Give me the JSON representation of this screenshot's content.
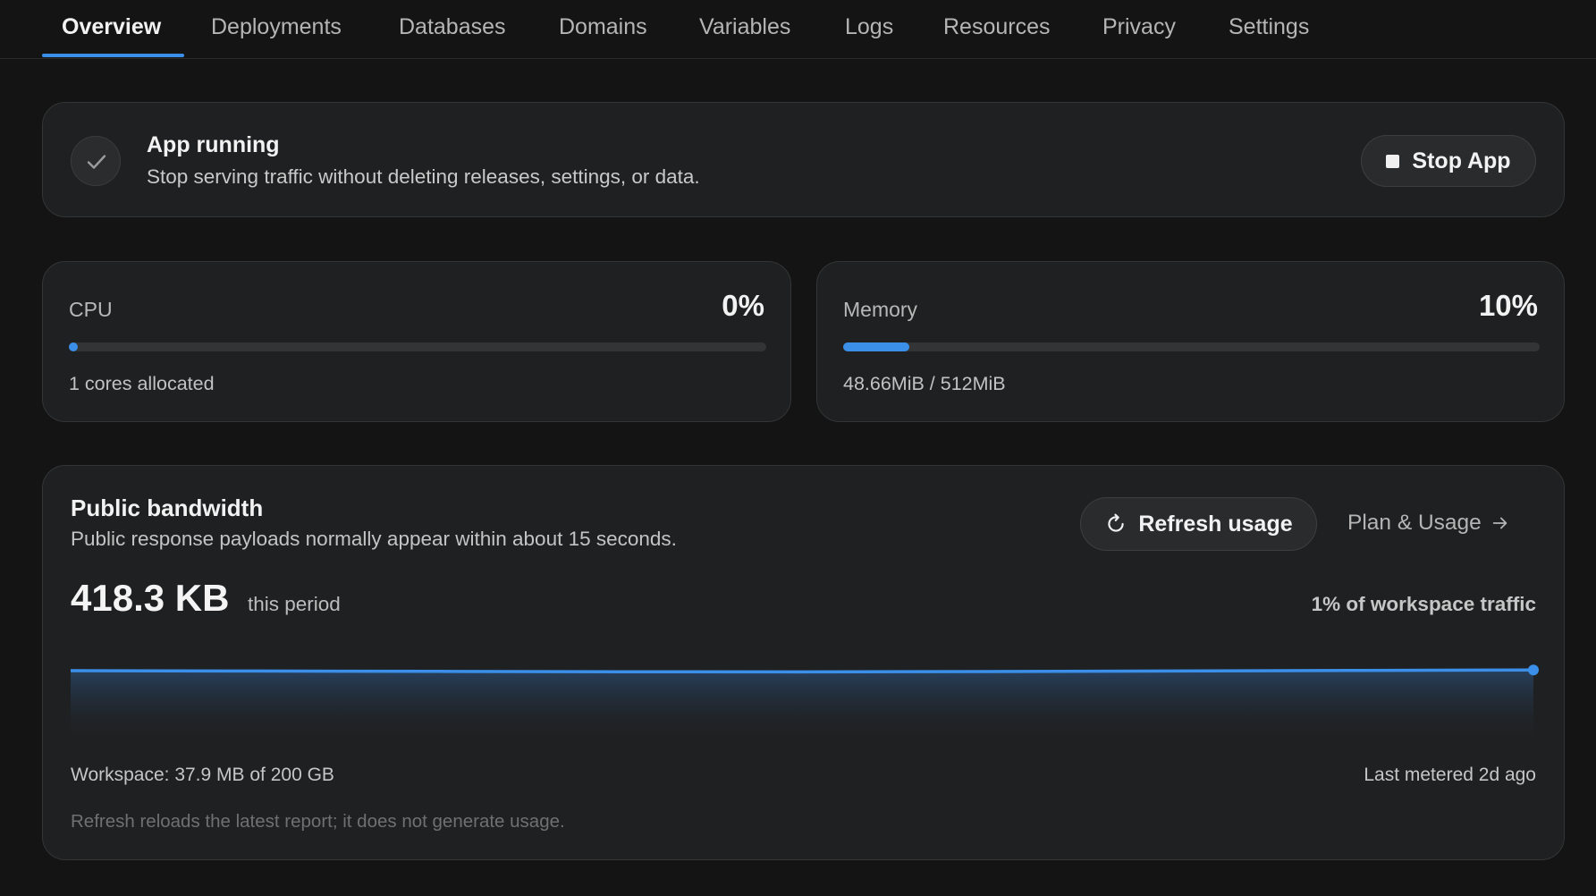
{
  "tabs": [
    {
      "label": "Overview",
      "active": true
    },
    {
      "label": "Deployments"
    },
    {
      "label": "Databases"
    },
    {
      "label": "Domains"
    },
    {
      "label": "Variables"
    },
    {
      "label": "Logs"
    },
    {
      "label": "Resources"
    },
    {
      "label": "Privacy"
    },
    {
      "label": "Settings"
    }
  ],
  "status": {
    "icon": "check-icon",
    "title": "App running",
    "description": "Stop serving traffic without deleting releases, settings, or data.",
    "stop_button": "Stop App"
  },
  "cpu": {
    "label": "CPU",
    "value": "0%",
    "fraction": 0.0,
    "sub": "1 cores allocated"
  },
  "memory": {
    "label": "Memory",
    "value": "10%",
    "fraction": 0.095,
    "sub": "48.66MiB / 512MiB"
  },
  "bandwidth": {
    "title": "Public bandwidth",
    "description": "Public response payloads normally appear within about 15 seconds.",
    "refresh_button": "Refresh usage",
    "plan_link": "Plan & Usage",
    "amount": "418.3 KB",
    "period": "this period",
    "share": "1% of workspace traffic",
    "workspace": "Workspace: 37.9 MB of 200 GB",
    "metered": "Last metered 2d ago",
    "note": "Refresh reloads the latest report; it does not generate usage."
  },
  "chart_data": {
    "type": "area",
    "values": [
      0.7,
      0.66,
      0.62,
      0.58,
      0.56,
      0.6,
      0.66,
      0.72,
      0.78
    ],
    "title": "",
    "xlabel": "",
    "ylabel": ""
  },
  "colors": {
    "accent": "#3b8fe8",
    "background": "#141414",
    "card": "#1f2021"
  }
}
